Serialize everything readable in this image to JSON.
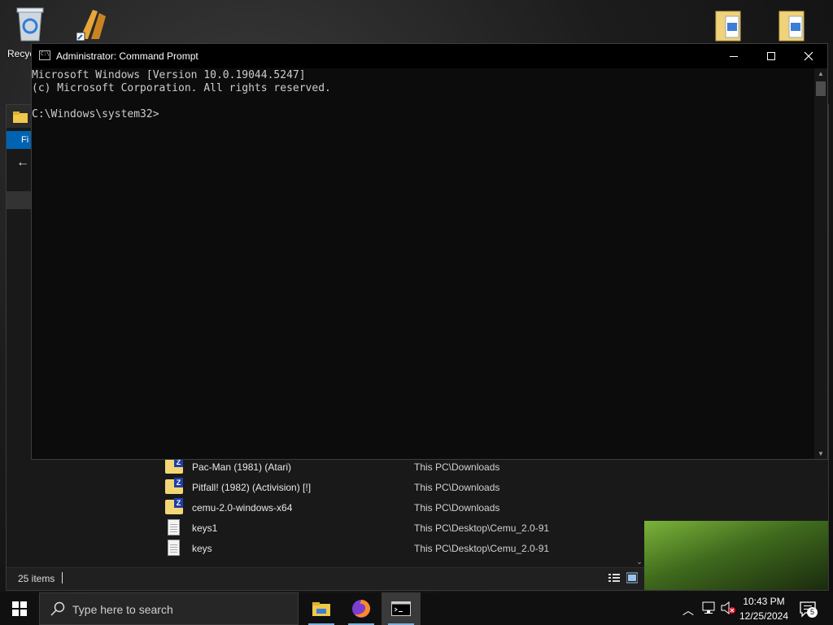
{
  "desktop": {
    "recycle_label": "Recyc"
  },
  "cmd": {
    "title": "Administrator: Command Prompt",
    "lines": [
      "Microsoft Windows [Version 10.0.19044.5247]",
      "(c) Microsoft Corporation. All rights reserved.",
      "",
      "C:\\Windows\\system32>"
    ],
    "minimize": "—",
    "maximize": "☐",
    "close": "✕"
  },
  "explorer": {
    "file_tab": "Fi",
    "files": [
      {
        "name": "Pac-Man (1981) (Atari)",
        "location": "This PC\\Downloads",
        "icon": "zip-folder-icon"
      },
      {
        "name": "Pitfall! (1982) (Activision) [!]",
        "location": "This PC\\Downloads",
        "icon": "zip-folder-icon"
      },
      {
        "name": "cemu-2.0-windows-x64",
        "location": "This PC\\Downloads",
        "icon": "zip-folder-icon"
      },
      {
        "name": "keys1",
        "location": "This PC\\Desktop\\Cemu_2.0-91",
        "icon": "text-file-icon"
      },
      {
        "name": "keys",
        "location": "This PC\\Desktop\\Cemu_2.0-91",
        "icon": "text-file-icon"
      }
    ],
    "status_count": "25 items"
  },
  "taskbar": {
    "search_placeholder": "Type here to search",
    "time": "10:43 PM",
    "date": "12/25/2024",
    "notification_count": "5"
  }
}
